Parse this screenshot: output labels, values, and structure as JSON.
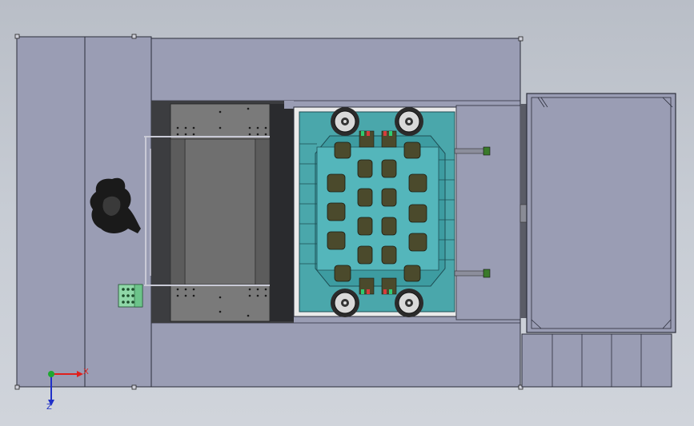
{
  "cad_view": {
    "axis_triad": {
      "x_label": "X",
      "z_label": "Z",
      "x_color": "#e0201c",
      "z_color": "#2030c8",
      "origin_color": "#1ea830"
    },
    "colors": {
      "background": "#c3c8d0",
      "frame_fill": "#9a9db4",
      "frame_stroke": "#2b2d3a",
      "mold_teal": "#4aa7ab",
      "mold_teal_dark": "#2f7f86",
      "cavity_fill": "#4b4a2c",
      "plate_gray": "#6f6f6f",
      "dark_steel": "#3c3d40",
      "accent_green": "#2ecc71",
      "accent_red": "#d63c3c"
    },
    "components": {
      "left_frame": "left-frame-panel",
      "conveyor": "conveyor-table",
      "mold": "mold-assembly",
      "right_cabinet": "right-cabinet",
      "operator": "operator-figure",
      "control_box": "control-box"
    }
  }
}
